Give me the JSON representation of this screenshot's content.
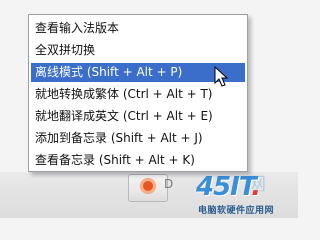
{
  "menu": {
    "items": [
      {
        "label": "查看输入法版本"
      },
      {
        "label": "全双拼切换"
      },
      {
        "label": "离线模式 (Shift + Alt + P)",
        "selected": true
      },
      {
        "label": "就地转换成繁体 (Ctrl + Alt + T)"
      },
      {
        "label": "就地翻译成英文 (Ctrl + Alt + E)"
      },
      {
        "label": "添加到备忘录 (Shift + Alt + J)"
      },
      {
        "label": "查看备忘录 (Shift + Alt + K)"
      }
    ]
  },
  "taskbar": {
    "tray_text": "D"
  },
  "watermark": {
    "main": "45IT",
    "dot": ".",
    "ghost": "网",
    "sub": "电脑软硬件应用网"
  },
  "colors": {
    "selection": "#3b6ecb",
    "watermark_blue": "#3b8fd8"
  }
}
